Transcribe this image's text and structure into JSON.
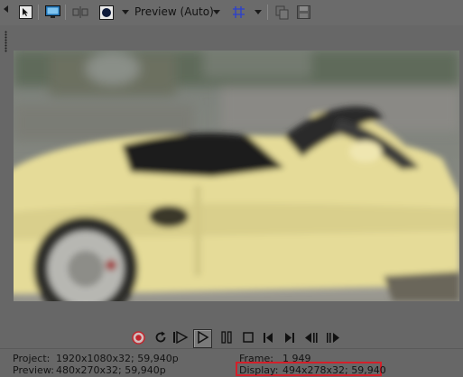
{
  "toolbar": {
    "preview_quality": "Preview (Auto)",
    "icons": [
      "properties-icon",
      "monitor-icon",
      "split-screen-icon",
      "overlay-icon",
      "grid-icon",
      "copy-snapshot-icon",
      "save-snapshot-icon"
    ]
  },
  "video": {
    "subject": "yellow convertible car"
  },
  "transport": {
    "icons": [
      "record-icon",
      "loop-icon",
      "play-from-start-icon",
      "play-icon",
      "pause-icon",
      "stop-icon",
      "go-to-start-icon",
      "go-to-end-icon",
      "previous-frame-icon",
      "next-frame-icon"
    ]
  },
  "info": {
    "project_label": "Project:",
    "project_value": "1920x1080x32; 59,940p",
    "preview_label": "Preview:",
    "preview_value": "480x270x32; 59,940p",
    "frame_label": "Frame:",
    "frame_value": "1 949",
    "display_label": "Display:",
    "display_value": "494x278x32; 59,940"
  },
  "colors": {
    "background": "#676767",
    "highlight": "#d4202a",
    "video_car": "#e6dc98"
  }
}
